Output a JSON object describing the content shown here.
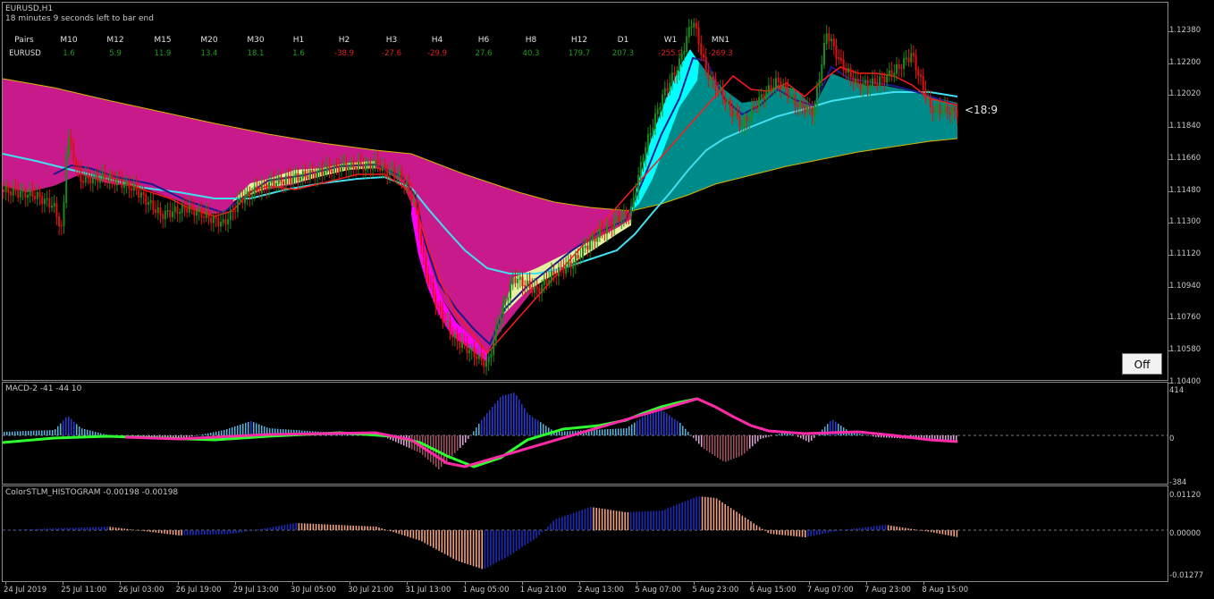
{
  "chart": {
    "symbol_tf": "EURUSD,H1",
    "countdown": "18 minutes 9 seconds left to bar end",
    "timer_label": "<18:9",
    "off_button": "Off"
  },
  "strength_table": {
    "pairs_header": "Pairs",
    "symbol": "EURUSD",
    "headers": [
      "M10",
      "M12",
      "M15",
      "M20",
      "M30",
      "H1",
      "H2",
      "H3",
      "H4",
      "H6",
      "H8",
      "H12",
      "D1",
      "W1",
      "MN1"
    ],
    "values": [
      "1.6",
      "5.9",
      "11.9",
      "13.4",
      "18.1",
      "1.6",
      "-38.9",
      "-27.6",
      "-29.9",
      "27.6",
      "40.3",
      "179.7",
      "207.3",
      "-255.9",
      "-269.3"
    ],
    "positive_color": "#1f9e1f",
    "negative_color": "#e02020"
  },
  "main_pane": {
    "price_scale": [
      "1.12380",
      "1.12200",
      "1.12020",
      "1.11840",
      "1.11660",
      "1.11480",
      "1.11300",
      "1.11120",
      "1.10940",
      "1.10760",
      "1.10580",
      "1.10400"
    ]
  },
  "macd_pane": {
    "label": "MACD-2 -41 -44 10",
    "scale": [
      "414",
      "0",
      "-384"
    ]
  },
  "stlm_pane": {
    "label": "ColorSTLM_HISTOGRAM -0.00198 -0.00198",
    "scale": [
      "0.01120",
      "0.00000",
      "-0.01277"
    ]
  },
  "time_axis": [
    "24 Jul 2019",
    "25 Jul 11:00",
    "26 Jul 03:00",
    "26 Jul 19:00",
    "29 Jul 13:00",
    "30 Jul 05:00",
    "30 Jul 21:00",
    "31 Jul 13:00",
    "1 Aug 05:00",
    "1 Aug 21:00",
    "2 Aug 13:00",
    "5 Aug 07:00",
    "5 Aug 23:00",
    "6 Aug 15:00",
    "7 Aug 07:00",
    "7 Aug 23:00",
    "8 Aug 15:00"
  ],
  "colors": {
    "cloud_bear": "#c81a8a",
    "cloud_bull": "#008b8b",
    "ma_cyan": "#40e0f0",
    "ma_yellow": "#d4b800",
    "ma_navy": "#1a1a90",
    "candle_bull": "#1a8a1a",
    "candle_bear": "#e01010"
  }
}
